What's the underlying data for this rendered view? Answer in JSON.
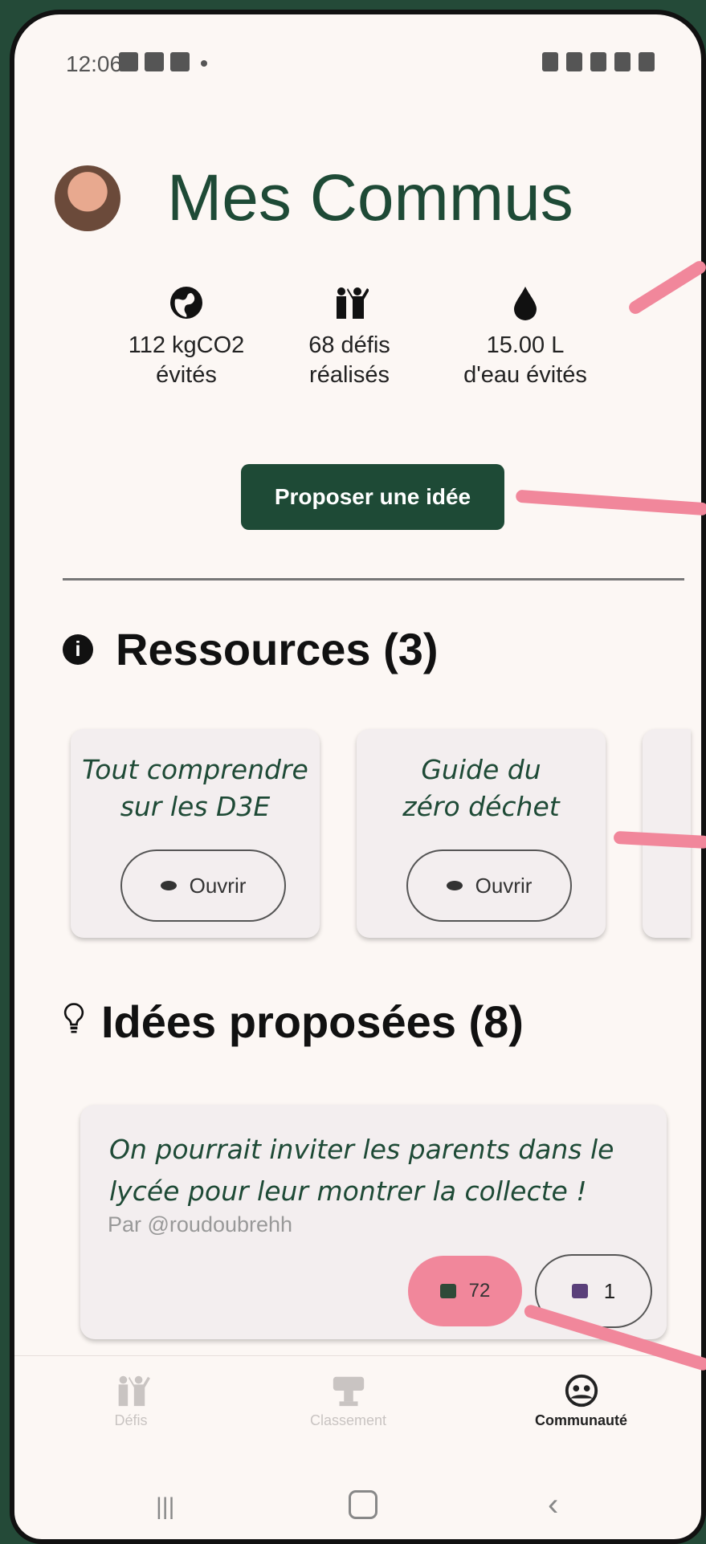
{
  "status_bar": {
    "time": "12:06"
  },
  "header": {
    "title": "Mes Commus"
  },
  "stats": [
    {
      "icon": "globe-icon",
      "line1": "112 kgCO2",
      "line2": "évités"
    },
    {
      "icon": "people-icon",
      "line1": "68 défis",
      "line2": "réalisés"
    },
    {
      "icon": "water-drop-icon",
      "line1": "15.00 L",
      "line2": "d'eau évités"
    }
  ],
  "propose_button": "Proposer une idée",
  "resources": {
    "title": "Ressources (3)",
    "items": [
      {
        "title": "Tout comprendre sur les D3E",
        "open_label": "Ouvrir"
      },
      {
        "title": "Guide du zéro déchet",
        "open_label": "Ouvrir"
      }
    ]
  },
  "ideas": {
    "title": "Idées proposées (8)",
    "items": [
      {
        "text": "On pourrait inviter les parents dans le lycée pour leur montrer la collecte !",
        "author": "Par @roudoubrehh",
        "likes": "72",
        "dislikes": "1"
      }
    ]
  },
  "nav": [
    {
      "label": "Défis",
      "icon": "people-icon",
      "active": false
    },
    {
      "label": "Classement",
      "icon": "trophy-icon",
      "active": false
    },
    {
      "label": "Communauté",
      "icon": "community-icon",
      "active": true
    }
  ],
  "colors": {
    "brand": "#1e4a36",
    "accent": "#f1879b",
    "background": "#fcf7f4"
  }
}
